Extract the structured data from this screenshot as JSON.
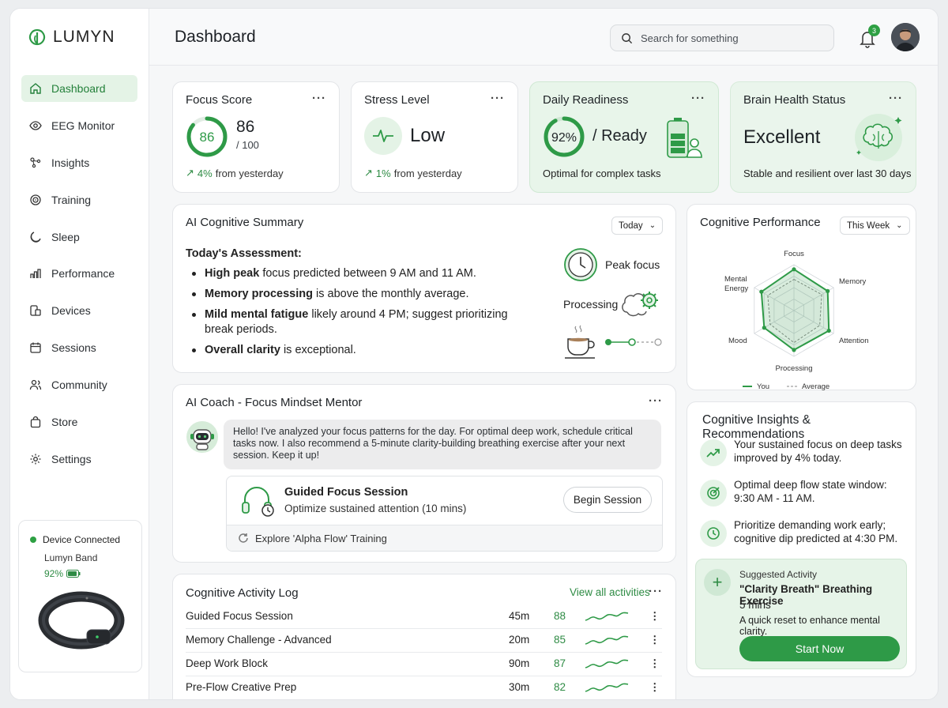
{
  "app": {
    "brand": "LUMYN",
    "page_title": "Dashboard"
  },
  "search": {
    "placeholder": "Search for something"
  },
  "notifications": {
    "count": "3"
  },
  "sidebar": {
    "items": [
      {
        "label": "Dashboard",
        "icon": "home-icon",
        "active": true
      },
      {
        "label": "EEG Monitor",
        "icon": "eye-icon"
      },
      {
        "label": "Insights",
        "icon": "sparkle-icon"
      },
      {
        "label": "Training",
        "icon": "target-icon"
      },
      {
        "label": "Sleep",
        "icon": "moon-icon"
      },
      {
        "label": "Performance",
        "icon": "bar-chart-icon"
      },
      {
        "label": "Devices",
        "icon": "device-icon"
      },
      {
        "label": "Sessions",
        "icon": "calendar-icon"
      },
      {
        "label": "Community",
        "icon": "people-icon"
      },
      {
        "label": "Store",
        "icon": "bag-icon"
      },
      {
        "label": "Settings",
        "icon": "gear-icon"
      }
    ],
    "device": {
      "status": "Device Connected",
      "name": "Lumyn Band",
      "battery": "92%",
      "battery_level": 0.92
    }
  },
  "stats": {
    "focus": {
      "title": "Focus Score",
      "ring": "86",
      "value": "86",
      "max": "/ 100",
      "delta": "4%",
      "delta_text": "from yesterday",
      "level": 0.86
    },
    "stress": {
      "title": "Stress Level",
      "value": "Low",
      "delta": "1%",
      "delta_text": "from yesterday"
    },
    "readiness": {
      "title": "Daily Readiness",
      "ring": "92%",
      "value": "/ Ready",
      "note": "Optimal for complex tasks",
      "level": 0.92
    },
    "brain": {
      "title": "Brain Health Status",
      "value": "Excellent",
      "note": "Stable and resilient over last 30 days"
    }
  },
  "summary": {
    "title": "AI Cognitive Summary",
    "period": "Today",
    "heading": "Today's Assessment:",
    "items": [
      {
        "bold": "High peak",
        "rest": " focus predicted between 9 AM and 11 AM."
      },
      {
        "bold": "Memory processing",
        "rest": " is above the monthly average."
      },
      {
        "bold": "Mild mental fatigue",
        "rest": " likely around 4 PM; suggest prioritizing break periods."
      },
      {
        "bold": "Overall clarity",
        "rest": " is exceptional."
      }
    ],
    "labels": {
      "peak": "Peak focus",
      "processing": "Processing"
    }
  },
  "coach": {
    "title": "AI Coach - Focus Mindset Mentor",
    "message": "Hello! I've analyzed your focus patterns for the day. For optimal deep work, schedule critical tasks now. I also recommend a 5-minute clarity-building breathing exercise after your next session. Keep it up!",
    "session_title": "Guided Focus Session",
    "session_sub": "Optimize sustained attention (10 mins)",
    "button": "Begin Session",
    "explore": "Explore 'Alpha Flow' Training"
  },
  "log": {
    "title": "Cognitive Activity Log",
    "view_all": "View all activities",
    "rows": [
      {
        "name": "Guided Focus Session",
        "duration": "45m",
        "score": "88"
      },
      {
        "name": "Memory Challenge - Advanced",
        "duration": "20m",
        "score": "85"
      },
      {
        "name": "Deep Work Block",
        "duration": "90m",
        "score": "87"
      },
      {
        "name": "Pre-Flow Creative Prep",
        "duration": "30m",
        "score": "82"
      }
    ]
  },
  "performance": {
    "title": "Cognitive Performance",
    "period": "This Week",
    "axis_labels": {
      "focus": "Focus",
      "memory": "Memory",
      "attention": "Attention",
      "processing": "Processing",
      "mood": "Mood",
      "energy1": "Mental",
      "energy2": "Energy"
    },
    "legend": {
      "you": "You",
      "average": "Average"
    }
  },
  "chart_data": {
    "type": "radar",
    "axes": [
      "Focus",
      "Memory",
      "Attention",
      "Processing",
      "Mood",
      "Mental Energy"
    ],
    "series": [
      {
        "name": "You",
        "values": [
          0.9,
          0.85,
          0.88,
          0.86,
          0.75,
          0.82
        ],
        "color": "#2e9a47"
      },
      {
        "name": "Average",
        "values": [
          0.68,
          0.7,
          0.65,
          0.7,
          0.6,
          0.66
        ],
        "color": "#888888"
      }
    ],
    "legend": "bottom"
  },
  "insights": {
    "title": "Cognitive Insights & Recommendations",
    "items": [
      {
        "text": "Your sustained focus on deep tasks improved by 4% today.",
        "icon": "trend-up-icon"
      },
      {
        "text": "Optimal deep flow state window: 9:30 AM - 11 AM.",
        "icon": "target-icon"
      },
      {
        "text": "Prioritize demanding work early; cognitive dip predicted at 4:30 PM.",
        "icon": "clock-icon"
      }
    ],
    "suggest": {
      "label": "Suggested Activity",
      "title": "\"Clarity Breath\" Breathing Exercise",
      "duration": "5 mins",
      "desc": "A quick reset to enhance mental clarity.",
      "button": "Start Now"
    }
  },
  "colors": {
    "accent": "#2e9a47",
    "accent_light": "#e4f3e6"
  }
}
